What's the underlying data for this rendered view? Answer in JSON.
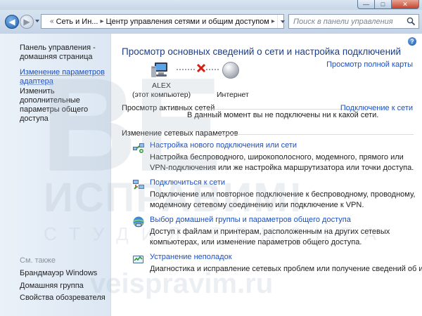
{
  "window": {
    "controls": {
      "minimize": "—",
      "maximize": "□",
      "close": "✕"
    }
  },
  "navbar": {
    "back_icon": "back-arrow-icon",
    "forward_icon": "forward-arrow-icon",
    "breadcrumb": [
      {
        "label": "Сеть и Ин..."
      },
      {
        "label": "Центр управления сетями и общим доступом"
      }
    ],
    "separator": "▸",
    "prefix": "«",
    "search_placeholder": "Поиск в панели управления"
  },
  "sidebar": {
    "home": "Панель управления - домашняя страница",
    "links": [
      {
        "label": "Изменение параметров адаптера"
      },
      {
        "label": "Изменить дополнительные параметры общего доступа"
      }
    ],
    "see_also_title": "См. также",
    "see_also": [
      {
        "label": "Брандмауэр Windows"
      },
      {
        "label": "Домашняя группа"
      },
      {
        "label": "Свойства обозревателя"
      }
    ]
  },
  "main": {
    "help": "?",
    "title": "Просмотр основных сведений о сети и настройка подключений",
    "full_map_link": "Просмотр полной карты",
    "network_map": {
      "computer_name": "ALEX",
      "computer_sub": "(этот компьютер)",
      "internet_label": "Интернет",
      "status_icon": "red-x-icon"
    },
    "active_networks": {
      "heading": "Просмотр активных сетей",
      "connect_link": "Подключение к сети",
      "status": "В данный момент вы не подключены ни к какой сети."
    },
    "change_settings": {
      "heading": "Изменение сетевых параметров",
      "tasks": [
        {
          "icon": "network-setup-icon",
          "link": "Настройка нового подключения или сети",
          "desc": "Настройка беспроводного, широкополосного, модемного, прямого или VPN-подключения или же настройка маршрутизатора или точки доступа."
        },
        {
          "icon": "connect-network-icon",
          "link": "Подключиться к сети",
          "desc": "Подключение или повторное подключение к беспроводному, проводному, модемному сетевому соединению или подключение к VPN."
        },
        {
          "icon": "homegroup-icon",
          "link": "Выбор домашней группы и параметров общего доступа",
          "desc": "Доступ к файлам и принтерам, расположенным на других сетевых компьютерах, или изменение параметров общего доступа."
        },
        {
          "icon": "troubleshoot-icon",
          "link": "Устранение неполадок",
          "desc": "Диагностика и исправление сетевых проблем или получение сведений об исправлении."
        }
      ]
    }
  },
  "watermark": {
    "big": "ВЕ",
    "mid": "ИСПРАВИМ!",
    "studio": "СТУДИЯ РЕМОНТА",
    "url": "veispravim.ru"
  }
}
